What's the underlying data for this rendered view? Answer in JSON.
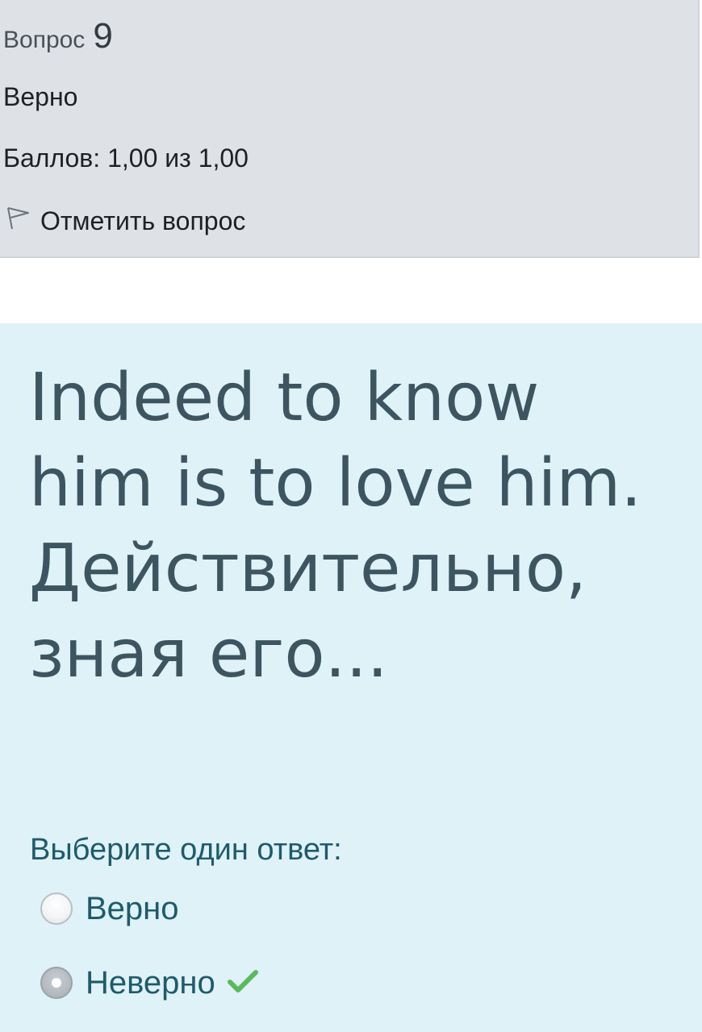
{
  "question_info": {
    "label": "Вопрос",
    "number": "9",
    "state": "Верно",
    "grade": "Баллов: 1,00 из 1,00",
    "flag_label": "Отметить вопрос"
  },
  "question": {
    "text": "Indeed to know him is to  love him. Действительно, зная его...",
    "prompt": "Выберите один ответ:",
    "answers": [
      {
        "label": "Верно",
        "selected": false
      },
      {
        "label": "Неверно",
        "selected": true,
        "correct_mark": "check-icon"
      }
    ]
  },
  "colors": {
    "info_bg": "#dee2e6",
    "content_bg": "#def2f8",
    "correct": "#5cb85c"
  }
}
